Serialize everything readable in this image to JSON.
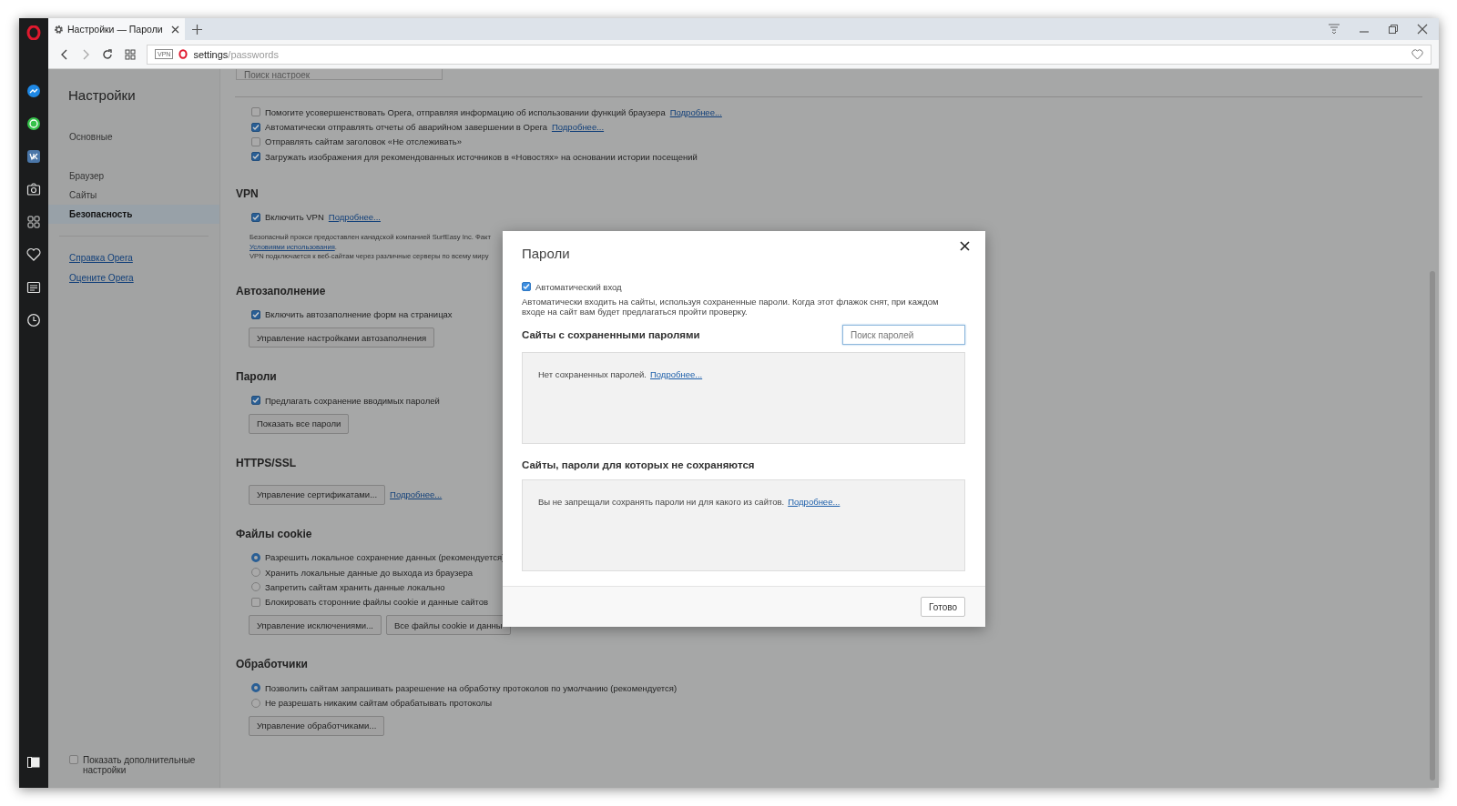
{
  "tabs": [
    {
      "title": "Настройки — Пароли"
    }
  ],
  "address_bar": {
    "vpn_badge": "VPN",
    "host": "settings",
    "path": "/passwords"
  },
  "settings_nav": {
    "title": "Настройки",
    "groups": [
      [
        {
          "label": "Основные",
          "selected": false
        }
      ],
      [
        {
          "label": "Браузер",
          "selected": false
        },
        {
          "label": "Сайты",
          "selected": false
        },
        {
          "label": "Безопасность",
          "selected": true
        }
      ]
    ],
    "links": [
      "Справка Opera",
      "Оцените Opera"
    ],
    "advanced": {
      "label": "Показать дополнительные настройки",
      "checked": false
    }
  },
  "search": {
    "placeholder": "Поиск настроек"
  },
  "sections": [
    {
      "items": [
        {
          "kind": "checkbox",
          "label": "Помогите усовершенствовать Opera, отправляя информацию об использовании функций браузера",
          "checked": false,
          "link": "Подробнее..."
        },
        {
          "kind": "checkbox",
          "label": "Автоматически отправлять отчеты об аварийном завершении в Opera",
          "checked": true,
          "link": "Подробнее..."
        },
        {
          "kind": "checkbox",
          "label": "Отправлять сайтам заголовок «Не отслеживать»",
          "checked": false
        },
        {
          "kind": "checkbox",
          "label": "Загружать изображения для рекомендованных источников в «Новостях» на основании истории посещений",
          "checked": true
        }
      ]
    },
    {
      "heading": "VPN",
      "items": [
        {
          "kind": "checkbox",
          "label": "Включить VPN",
          "checked": true,
          "link": "Подробнее..."
        },
        {
          "kind": "note",
          "text": "Безопасный прокси предоставлен канадской компанией SurfEasy Inc. Факт"
        },
        {
          "kind": "note-link",
          "link": "Условиями использования",
          "after": "."
        },
        {
          "kind": "note",
          "text": "VPN подключается к веб-сайтам через различные серверы по всему миру"
        }
      ]
    },
    {
      "heading": "Автозаполнение",
      "items": [
        {
          "kind": "checkbox",
          "label": "Включить автозаполнение форм на страницах",
          "checked": true
        },
        {
          "kind": "buttons",
          "buttons": [
            "Управление настройками автозаполнения"
          ]
        }
      ]
    },
    {
      "heading": "Пароли",
      "items": [
        {
          "kind": "checkbox",
          "label": "Предлагать сохранение вводимых паролей",
          "checked": true
        },
        {
          "kind": "buttons",
          "buttons": [
            "Показать все пароли"
          ]
        }
      ]
    },
    {
      "heading": "HTTPS/SSL",
      "items": [
        {
          "kind": "buttons",
          "buttons": [
            "Управление сертификатами..."
          ],
          "link": "Подробнее..."
        }
      ]
    },
    {
      "heading": "Файлы cookie",
      "items": [
        {
          "kind": "radio",
          "label": "Разрешить локальное сохранение данных (рекомендуется)",
          "selected": true
        },
        {
          "kind": "radio",
          "label": "Хранить локальные данные до выхода из браузера",
          "selected": false
        },
        {
          "kind": "radio",
          "label": "Запретить сайтам хранить данные локально",
          "selected": false
        },
        {
          "kind": "checkbox",
          "label": "Блокировать сторонние файлы cookie и данные сайтов",
          "checked": false
        },
        {
          "kind": "buttons",
          "buttons": [
            "Управление исключениями...",
            "Все файлы cookie и данны"
          ]
        }
      ]
    },
    {
      "heading": "Обработчики",
      "items": [
        {
          "kind": "radio",
          "label": "Позволить сайтам запрашивать разрешение на обработку протоколов по умолчанию (рекомендуется)",
          "selected": true
        },
        {
          "kind": "radio",
          "label": "Не разрешать никаким сайтам обрабатывать протоколы",
          "selected": false
        },
        {
          "kind": "buttons",
          "buttons": [
            "Управление обработчиками..."
          ]
        }
      ]
    }
  ],
  "dialog": {
    "title": "Пароли",
    "auto_signin": {
      "label": "Автоматический вход",
      "checked": true
    },
    "description": "Автоматически входить на сайты, используя сохраненные пароли. Когда этот флажок снят, при каждом входе на сайт вам будет предлагаться пройти проверку.",
    "saved": {
      "heading": "Сайты с сохраненными паролями",
      "search_placeholder": "Поиск паролей",
      "empty_text": "Нет сохраненных паролей.",
      "link": "Подробнее..."
    },
    "never_saved": {
      "heading": "Сайты, пароли для которых не сохраняются",
      "empty_text": "Вы не запрещали сохранять пароли ни для какого из сайтов.",
      "link": "Подробнее..."
    },
    "done_button": "Готово"
  }
}
